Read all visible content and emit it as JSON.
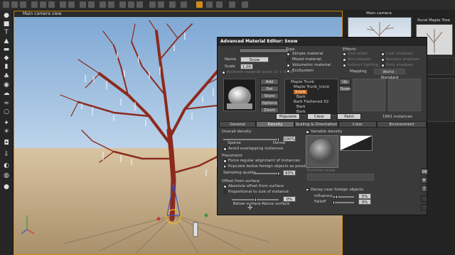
{
  "viewport": {
    "title": "Main camera view"
  },
  "right_panel": {
    "camera_title": "Main camera",
    "object_title": "Rural Maple Tree"
  },
  "editor": {
    "title": "Advanced Material Editor: Snow",
    "name_label": "Name",
    "name_value": "Snow",
    "scale_label": "Scale",
    "scale_value": "1.00",
    "animate_label": "Animate material scale (Z + time)",
    "type": {
      "header": "Type",
      "options": [
        {
          "label": "Simple material",
          "selected": false
        },
        {
          "label": "Mixed material",
          "selected": true
        },
        {
          "label": "Volumetric material",
          "selected": false
        },
        {
          "label": "EcoSystem",
          "selected": false
        }
      ]
    },
    "effects": {
      "header": "Effects",
      "items": [
        "One sided",
        "Cast shadows",
        "Anti-aliased",
        "Receive shadows",
        "Indirect lighting",
        "Only shadows"
      ],
      "mapping_label": "Mapping",
      "mapping_value": "World - Standard"
    },
    "layer_buttons": [
      "Add layer",
      "Del layer",
      "Store",
      "Options",
      "Zoom"
    ],
    "tree_items": [
      "Maple Trunk",
      "Maple Trunk_Icicle",
      "Snow",
      "Bark",
      "Bark Flattened 02",
      "Bark",
      "Bark"
    ],
    "up_label": "Up",
    "down_label": "Down",
    "action_buttons": [
      "Populate",
      "Clear",
      "Paint"
    ],
    "instances": "1661 instances",
    "tabs": [
      "General",
      "Density",
      "Scaling & Orientation",
      "Color",
      "Environment"
    ],
    "active_tab": "Density",
    "density": {
      "overall_header": "Overall density",
      "overall_value": "100%",
      "sparse": "Sparse",
      "dense": "Dense",
      "avoid_label": "Avoid overlapping instances",
      "placement_header": "Placement",
      "force_label": "Force regular alignment of instances",
      "populate_label": "Populate below foreign objects as possible",
      "sampling_label": "Sampling quality",
      "sampling_value": "93%",
      "offset_header": "Offset from surface",
      "absolute_label": "Absolute offset from surface",
      "proportional_label": "Proportional to size of instance",
      "offset_value": "0%",
      "below_label": "Below surface",
      "above_label": "Above surface",
      "variable_label": "Variable density",
      "function_scale_label": "Function scale",
      "decay_label": "Decay near foreign objects",
      "influence_label": "Influence",
      "influence_value": "5%",
      "falloff_label": "Falloff",
      "falloff_value": "0%"
    },
    "side_buttons": [
      "OK",
      "✕",
      "?"
    ]
  },
  "colors": {
    "accent": "#d48a1a",
    "trunk": "#8c2a1c",
    "sky": "#9dbde0",
    "ground": "#c9b18c"
  }
}
